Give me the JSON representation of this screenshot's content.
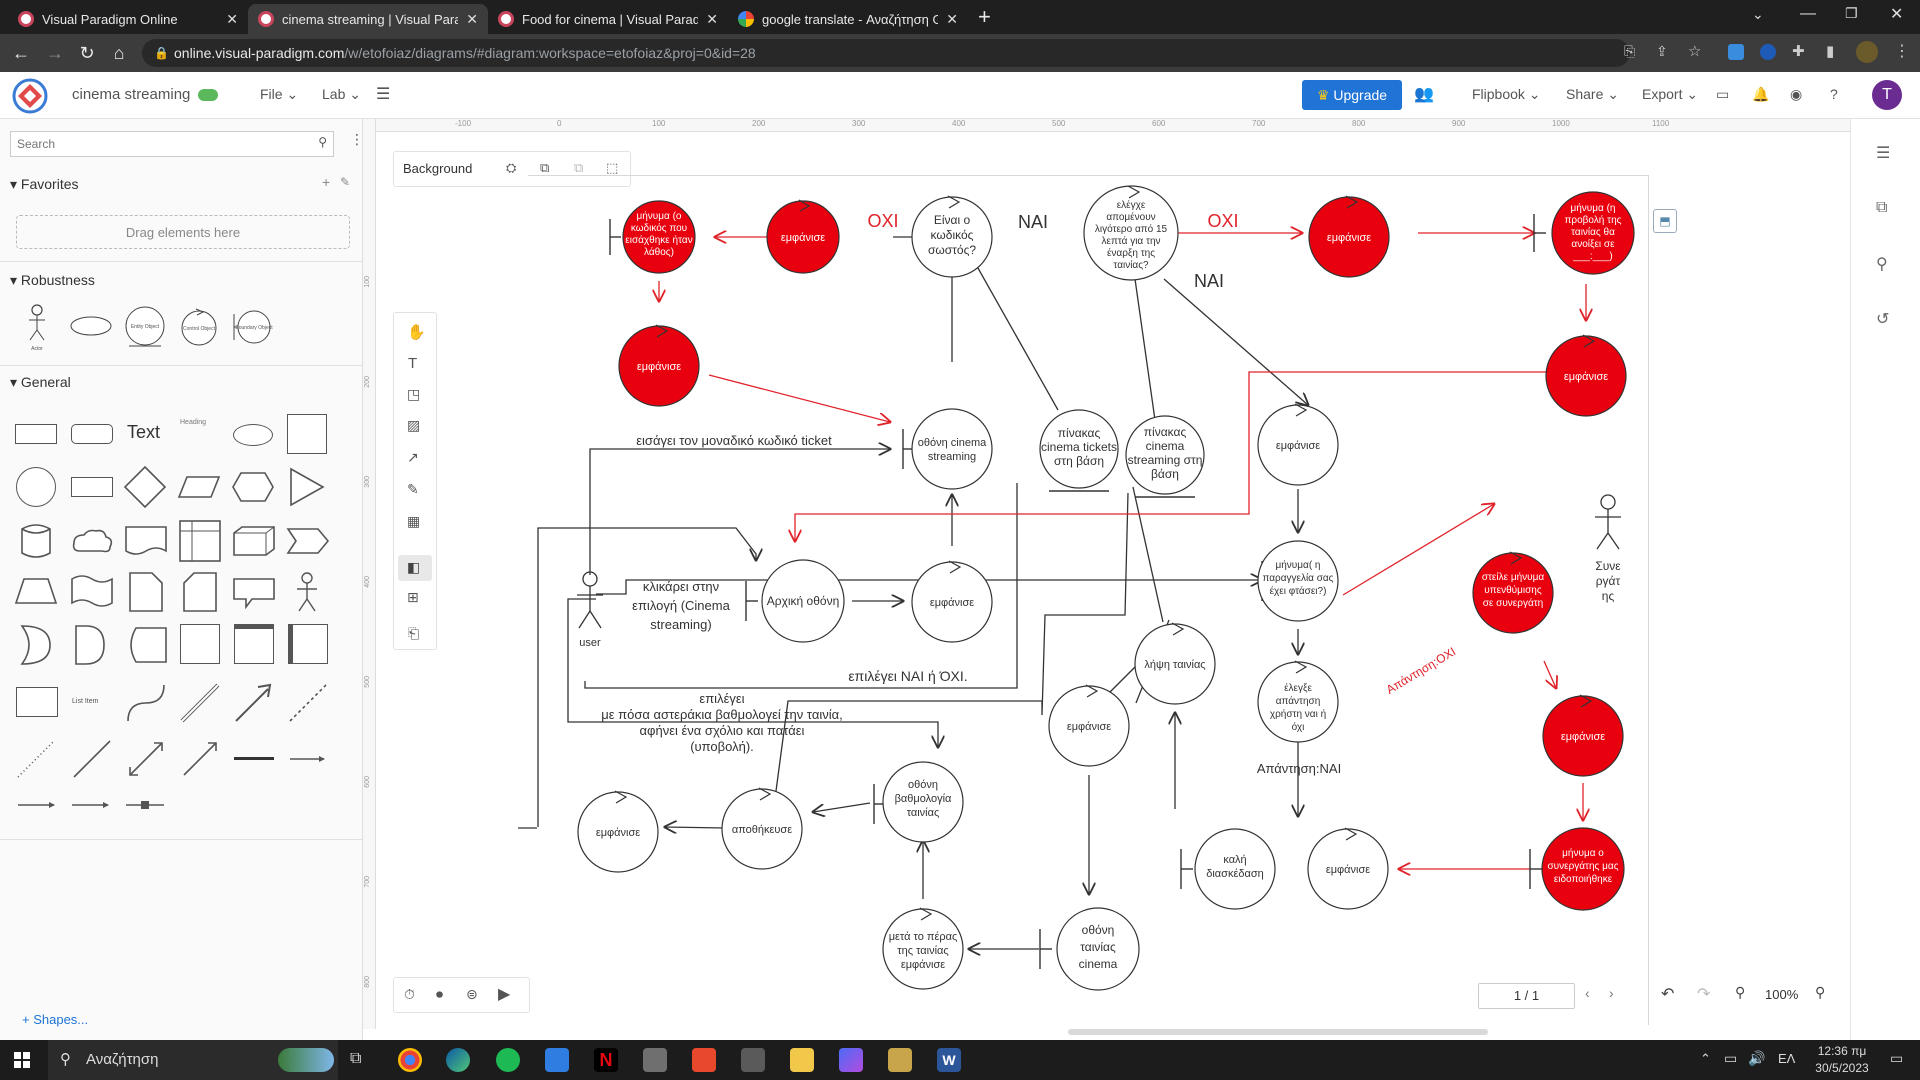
{
  "browser": {
    "tabs": [
      {
        "title": "Visual Paradigm Online"
      },
      {
        "title": "cinema streaming | Visual Paradig"
      },
      {
        "title": "Food for cinema | Visual Paradigm"
      },
      {
        "title": "google translate - Αναζήτηση Go"
      }
    ],
    "url_host": "online.visual-paradigm.com",
    "url_path": "/w/etofoiaz/diagrams/#diagram:workspace=etofoiaz&proj=0&id=28"
  },
  "header": {
    "doc_title": "cinema streaming",
    "menu_file": "File",
    "menu_lab": "Lab",
    "upgrade": "Upgrade",
    "flipbook": "Flipbook",
    "share": "Share",
    "export": "Export",
    "avatar_letter": "T"
  },
  "sidebar": {
    "search_placeholder": "Search",
    "favorites": "Favorites",
    "drag_here": "Drag elements here",
    "robustness": "Robustness",
    "robustness_labels": [
      "Actor",
      "Entity Object",
      "Control Object",
      "Boundary Object"
    ],
    "general": "General",
    "text_label": "Text",
    "heading_label": "Heading",
    "list_item_label": "List Item",
    "shapes_link": "+ Shapes..."
  },
  "canvas": {
    "background_label": "Background",
    "ruler_top": [
      "-100",
      "0",
      "100",
      "200",
      "300",
      "400",
      "500",
      "600",
      "700",
      "800",
      "900",
      "1000",
      "1100"
    ],
    "ruler_left": [
      "100",
      "200",
      "300",
      "400",
      "500",
      "600",
      "700",
      "800"
    ],
    "page_indicator": "1 / 1",
    "zoom": "100%"
  },
  "diagram": {
    "n_msg_wrong_code": "μήνυμα (ο κωδικός που εισάχθηκε ήταν λάθος)",
    "n_show_red1": "εμφάνισε",
    "n_code_correct": "Είναι ο κωδικός σωστός?",
    "n_check_time": "ελέγχει απομένουν λιγότερο από 15 λεπτά για την έναρξη της ταινίας?",
    "n_show_red2": "εμφάνισε",
    "n_msg_not_open": "μήνυμα (η προβολή της ταινίας θα ανοίξει σε ___:___)",
    "n_show_red3": "εμφάνισε",
    "n_show_red4": "εμφάνισε",
    "n_screen_streaming": "οθόνη cinema streaming",
    "n_table_tickets": "πίνακας cinema tickets στη βάση",
    "n_table_streaming": "πίνακας cinema streaming στη βάση",
    "n_show1": "εμφάνισε",
    "n_home_screen": "Αρχική οθόνη",
    "n_show2": "εμφάνισε",
    "n_msg_order": "μήνυμα( η παραγγελία σας έχει φτάσει?)",
    "n_remind_partner": "στείλε μήνυμα υπενθύμισης σε συνεργάτη",
    "n_actor_partner": "Συνε ργάτ ης",
    "n_actor_user": "user",
    "n_get_movie": "λήψη ταινίας",
    "n_check_answer": "έλεγξε απάντηση χρήστη ναι ή όχι",
    "n_show3": "εμφάνισε",
    "n_show_red5": "εμφάνισε",
    "n_rating_screen": "οθόνη βαθμολογία ταινίας",
    "n_save": "αποθήκευσε",
    "n_show4": "εμφάνισε",
    "n_enjoy": "καλή διασκέδαση",
    "n_show5": "εμφάνισε",
    "n_msg_partner_notified": "μήνυμα ο συνεργάτης μας ειδοποιήθηκε",
    "n_after_end": "μετά το πέρας της ταινίας εμφάνισε",
    "n_movie_screen": "οθόνη ταινίας cinema",
    "l_oxi1": "ΟΧΙ",
    "l_nai1": "ΝΑΙ",
    "l_oxi2": "ΟΧΙ",
    "l_nai2": "ΝΑΙ",
    "l_enter_code": "εισάγει τον μοναδικό κωδικό ticket",
    "l_click_option": "κλικάρει στην επιλογή (Cinema streaming)",
    "l_select_yes_no": "επιλέγει ΝΑΙ ή ΌΧΙ.",
    "l_rating_line1": "επιλέγει",
    "l_rating_line2": "με πόσα αστεράκια βαθμολογεί την ταινία,",
    "l_rating_line3": "αφήνει ένα σχόλιο και πατάει",
    "l_rating_line4": "(υποβολή).",
    "l_answer_oxi": "Απάντηση:ΟΧΙ",
    "l_answer_nai": "Απάντηση:ΝΑΙ"
  },
  "taskbar": {
    "search": "Αναζήτηση",
    "lang": "ΕΛ",
    "time": "12:36 πμ",
    "date": "30/5/2023"
  }
}
